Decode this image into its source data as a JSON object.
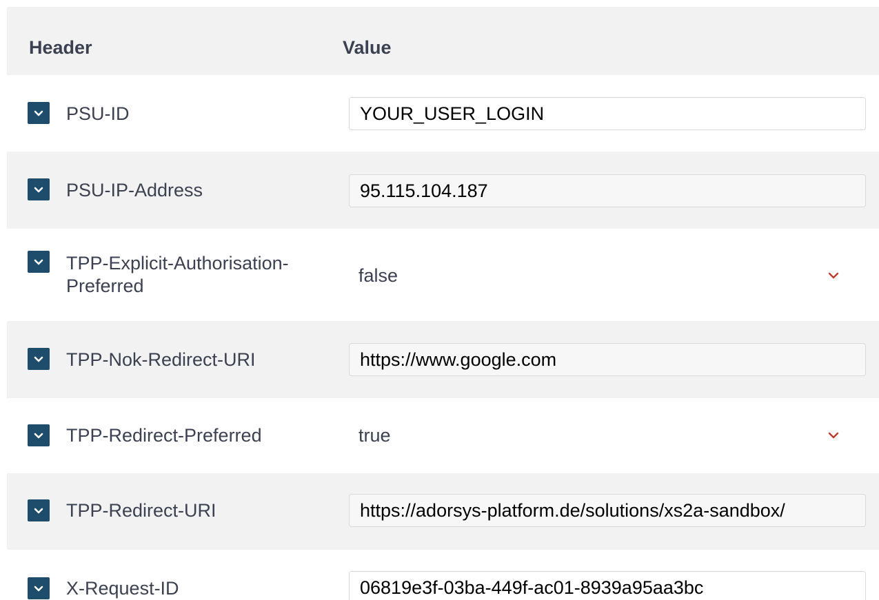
{
  "columns": {
    "header": "Header",
    "value": "Value"
  },
  "rows": [
    {
      "name": "PSU-ID",
      "name_line2": "",
      "value": "YOUR_USER_LOGIN",
      "checked": true,
      "control": "text-input"
    },
    {
      "name": "PSU-IP-Address",
      "name_line2": "",
      "value": "95.115.104.187",
      "checked": true,
      "control": "text-input"
    },
    {
      "name": "TPP-Explicit-Authorisation-",
      "name_line2": "Preferred",
      "value": "false",
      "checked": true,
      "control": "select"
    },
    {
      "name": "TPP-Nok-Redirect-URI",
      "name_line2": "",
      "value": "https://www.google.com",
      "checked": true,
      "control": "text-input"
    },
    {
      "name": "TPP-Redirect-Preferred",
      "name_line2": "",
      "value": "true",
      "checked": true,
      "control": "select"
    },
    {
      "name": "TPP-Redirect-URI",
      "name_line2": "",
      "value": "https://adorsys-platform.de/solutions/xs2a-sandbox/",
      "checked": true,
      "control": "text-input"
    },
    {
      "name": "X-Request-ID",
      "name_line2": "",
      "value": "06819e3f-03ba-449f-ac01-8939a95aa3bc",
      "checked": true,
      "control": "text-input"
    }
  ],
  "icons": {
    "checkbox": "check-icon",
    "dropdown": "chevron-down-icon"
  },
  "colors": {
    "checkbox": "#1e4d6b",
    "chevron": "#c0392b",
    "row_shade": "#f2f2f2",
    "text": "#3b4151"
  }
}
